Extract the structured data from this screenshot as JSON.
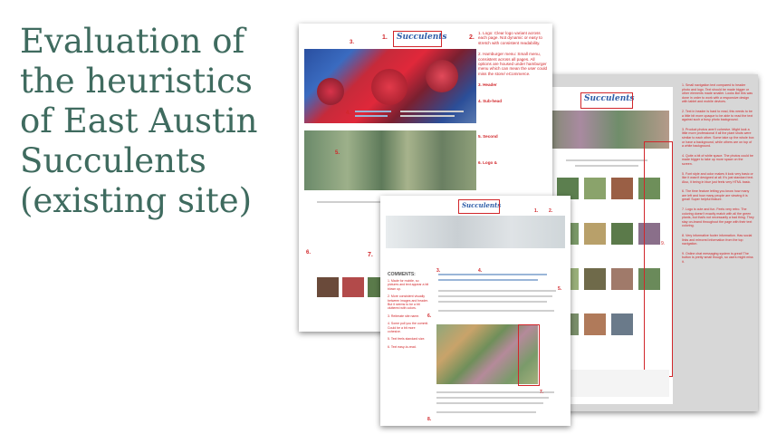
{
  "slide": {
    "title_lines": [
      "Evaluation of",
      "the heuristics",
      "of East Austin",
      "Succulents",
      "(existing site)"
    ]
  },
  "doc1": {
    "logo": "Succulents",
    "nums": [
      "1.",
      "2.",
      "3.",
      "4.",
      "5.",
      "6.",
      "7."
    ],
    "notes": [
      "1. Logo: Clear logo variant across each page. Not dynamic or easy to stretch with consistent readability.",
      "2. Hamburger menu: Small menu, consistent across all pages. All options are housed under hamburger menu which can mean the user could miss the store/ eCommerce.",
      "3. Header",
      "4. Sub-head",
      "5. Second",
      "6. Logo &"
    ]
  },
  "doc2": {
    "logo": "Succulents",
    "notes": [
      "1. Small navigation text compared to header photo and logo. Text should be made bigger or other elements made smaller. Looks like this was done in order to work with a responsive design with tablet and mobile devices.",
      "2. Text in header is hard to read, this needs to be a little bit more opaque to be able to read the text against such a busy photo background.",
      "3. Product photos aren't cohesive. Might look a little more professional if all the plant shots were similar to each other. Some take up the whole box or have a background, while others are on top of a white background.",
      "4. Quite a bit of white space. The photos could be made bigger to take up more space on the screen.",
      "5. Font style and color makes it look very basic or like it wasn't designed at all. It's just standard text. Also, it being in blue just feels very HTML basic.",
      "6. The time feature letting you know how many are left and how many people are viewing it is great! Super helpful feature.",
      "7. Logo is cute and fun. Feels very retro. The coloring doesn't exactly match with all the green plants, but that's not necessarily a bad thing. They stay on-brand throughout the page with their text coloring.",
      "8. Very informative footer information. Has social links and mirrored information from the top navigation.",
      "9. Online chat messaging system is great! The button is pretty small though, so users might miss it."
    ],
    "side_num": "9."
  },
  "doc3": {
    "logo": "Succulents",
    "heading": "COMMENTS:",
    "nums": [
      "1.",
      "2.",
      "3.",
      "4.",
      "5.",
      "6.",
      "7.",
      "8.",
      "9.",
      "10.",
      "11."
    ],
    "comments": [
      "1. Made for mobile, so pictures and text appear a bit blown up.",
      "2. More consistent visually between images and header. But it seems to be a bit cluttered with colors.",
      "3. Reiterate site name.",
      "4. Some pull you the commit. Could be a bit more cohesive.",
      "5. Text feels standard size.",
      "6. Text easy-to-read."
    ]
  },
  "colors": {
    "title": "#3f6b5f",
    "annotation": "#d1262a",
    "link_blue": "#3a72b5",
    "backdrop": "#d7d7d7"
  }
}
